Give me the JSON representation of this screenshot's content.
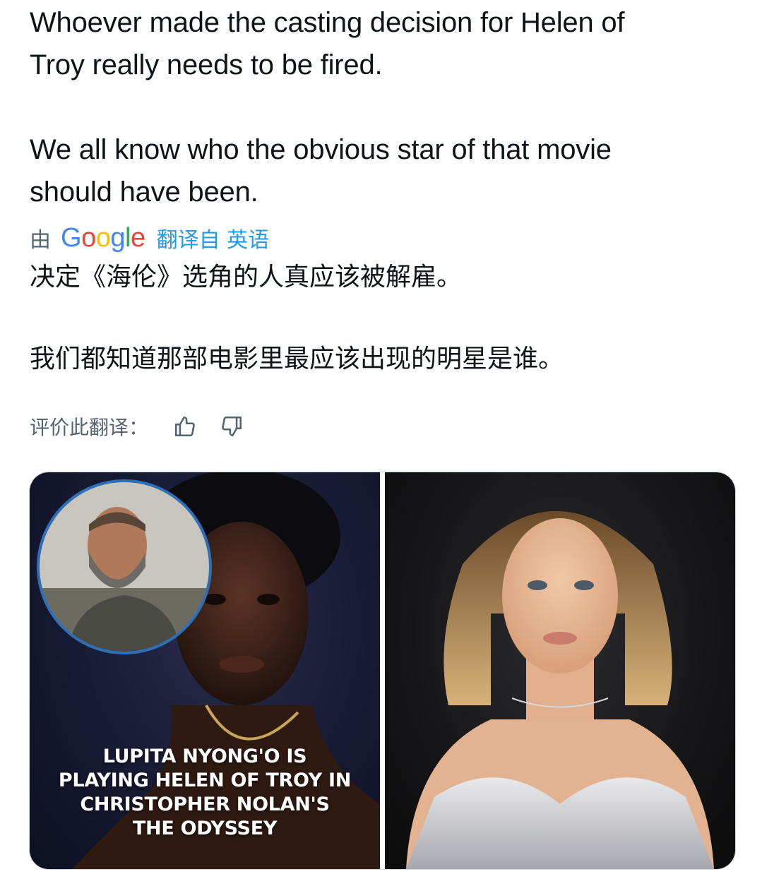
{
  "tweet": {
    "text": "Whoever made the casting decision for Helen of\nTroy really needs to be fired.\n\nWe all know who the obvious star of that movie\nshould have been."
  },
  "translation": {
    "by_label": "由",
    "provider_logo": "Google",
    "translated_from": "翻译自 英语",
    "text": "决定《海伦》选角的人真应该被解雇。\n\n我们都知道那部电影里最应该出现的明星是谁。",
    "rate_label": "评价此翻译：",
    "thumbs_up_icon": "thumbs-up-icon",
    "thumbs_down_icon": "thumbs-down-icon"
  },
  "media": {
    "left": {
      "caption": "LUPITA NYONG'O IS\nPLAYING HELEN OF TROY IN\nCHRISTOPHER NOLAN'S\nTHE ODYSSEY"
    }
  },
  "colors": {
    "link_blue": "#1d9bf0",
    "muted_gray": "#536471",
    "text": "#0f1419",
    "border": "#cfd9de"
  }
}
